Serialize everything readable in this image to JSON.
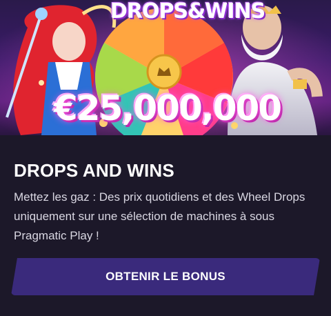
{
  "banner": {
    "art_title": "DROPS&WINS",
    "jackpot": "€25,000,000"
  },
  "card": {
    "title": "DROPS AND WINS",
    "description": "Mettez les gaz : Des prix quotidiens et des Wheel Drops uniquement sur une sélection de machines à sous Pragmatic Play !",
    "cta_label": "OBTENIR LE BONUS"
  },
  "colors": {
    "background": "#1c1829",
    "cta_background": "#3a2a7c",
    "text_primary": "#ffffff",
    "text_secondary": "#d9d7e2"
  }
}
